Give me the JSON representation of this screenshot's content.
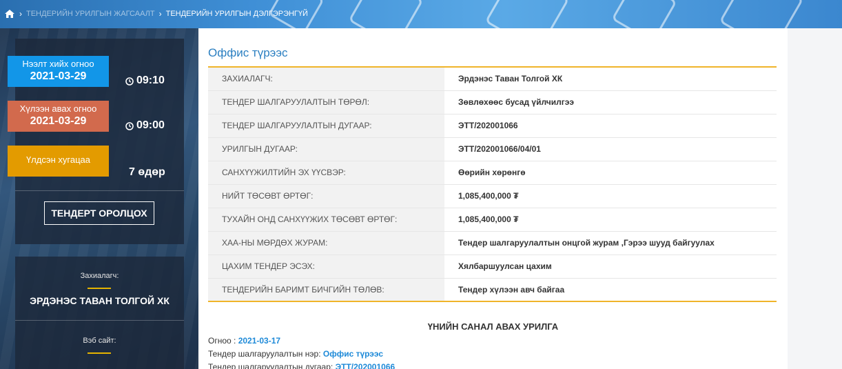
{
  "breadcrumb": {
    "items": [
      "ТЕНДЕРИЙН УРИЛГЫН ЖАГСААЛТ",
      "ТЕНДЕРИЙН УРИЛГЫН ДЭЛГЭРЭНГҮЙ"
    ]
  },
  "sidebar": {
    "open_date": {
      "label": "Нээлт хийх огноо",
      "date": "2021-03-29",
      "time": "09:10"
    },
    "receive_date": {
      "label": "Хүлээн авах огноо",
      "date": "2021-03-29",
      "time": "09:00"
    },
    "remaining": {
      "label": "Үлдсэн хугацаа",
      "value": "7 өдөр"
    },
    "join_button": "ТЕНДЕРТ ОРОЛЦОХ",
    "client_label": "Захиалагч:",
    "client_value": "ЭРДЭНЭС ТАВАН ТОЛГОЙ ХК",
    "website_label": "Вэб сайт:"
  },
  "main": {
    "title": "Оффис түрээс",
    "rows": [
      {
        "key": "Захиалагч:",
        "value": "Эрдэнэс Таван Толгой ХК"
      },
      {
        "key": "Тендер шалгаруулалтын төрөл:",
        "value": "Зөвлөхөөс бусад үйлчилгээ"
      },
      {
        "key": "Тендер шалгаруулалтын дугаар:",
        "value": "ЭТТ/202001066"
      },
      {
        "key": "Урилгын дугаар:",
        "value": "ЭТТ/202001066/04/01"
      },
      {
        "key": "Санхүүжилтийн эх үүсвэр:",
        "value": "Өөрийн хөрөнгө"
      },
      {
        "key": "Нийт төсөвт өртөг:",
        "value": "1,085,400,000 ₮"
      },
      {
        "key": "Тухайн онд санхүүжих төсөвт өртөг:",
        "value": "1,085,400,000 ₮"
      },
      {
        "key": "ХАА-ны мөрдөх журам:",
        "value": "Тендер шалгаруулалтын онцгой журам ,Гэрээ шууд байгуулах"
      },
      {
        "key": "Цахим тендер эсэх:",
        "value": "Хялбаршуулсан цахим"
      },
      {
        "key": "Тендерийн баримт бичгийн төлөв:",
        "value": "Тендер хүлээн авч байгаа"
      }
    ],
    "section_title": "ҮНИЙН САНАЛ АВАХ УРИЛГА",
    "details": [
      {
        "label": "Огноо : ",
        "value": "2021-03-17"
      },
      {
        "label": "Тендер шалгаруулалтын нэр: ",
        "value": "Оффис түрээс"
      },
      {
        "label": "Тендер шалгаруулалтын дугаар: ",
        "value": "ЭТТ/202001066"
      }
    ]
  },
  "colors": {
    "accent_blue": "#1296e8",
    "accent_orange": "#d26a4d",
    "accent_yellow": "#e39b00",
    "table_border": "#f0b429",
    "title_blue": "#2b7fc1"
  }
}
